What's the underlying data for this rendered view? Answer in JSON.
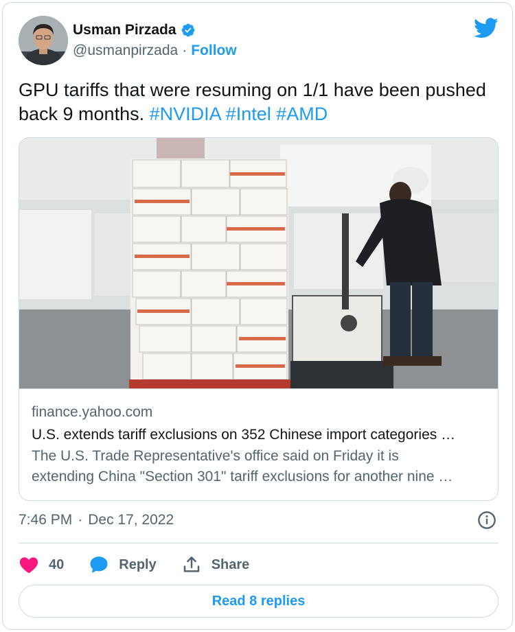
{
  "author": {
    "name": "Usman Pirzada",
    "handle": "@usmanpirzada",
    "separator": "·",
    "follow_label": "Follow",
    "verified_icon": "verified-badge-icon"
  },
  "tweet": {
    "text_plain": "GPU tariffs that were resuming on 1/1 have been pushed back 9 months. ",
    "hashtags": [
      "#NVIDIA",
      "#Intel",
      "#AMD"
    ]
  },
  "card": {
    "image_alt": "Worker moving a pallet of boxes in a warehouse",
    "domain": "finance.yahoo.com",
    "title": "U.S. extends tariff exclusions on 352 Chinese import categories …",
    "description_line1": "The U.S. Trade Representative's office said on Friday it is",
    "description_line2": "extending China \"Section 301\" tariff exclusions for another nine …"
  },
  "meta": {
    "time": "7:46 PM",
    "separator": "·",
    "date": "Dec 17, 2022"
  },
  "actions": {
    "like_count": "40",
    "reply_label": "Reply",
    "share_label": "Share"
  },
  "read_replies_label": "Read 8 replies",
  "colors": {
    "accent": "#1d9bf0",
    "like": "#f91880",
    "text": "#0f1419",
    "muted": "#536471",
    "border": "#cfd9de"
  }
}
